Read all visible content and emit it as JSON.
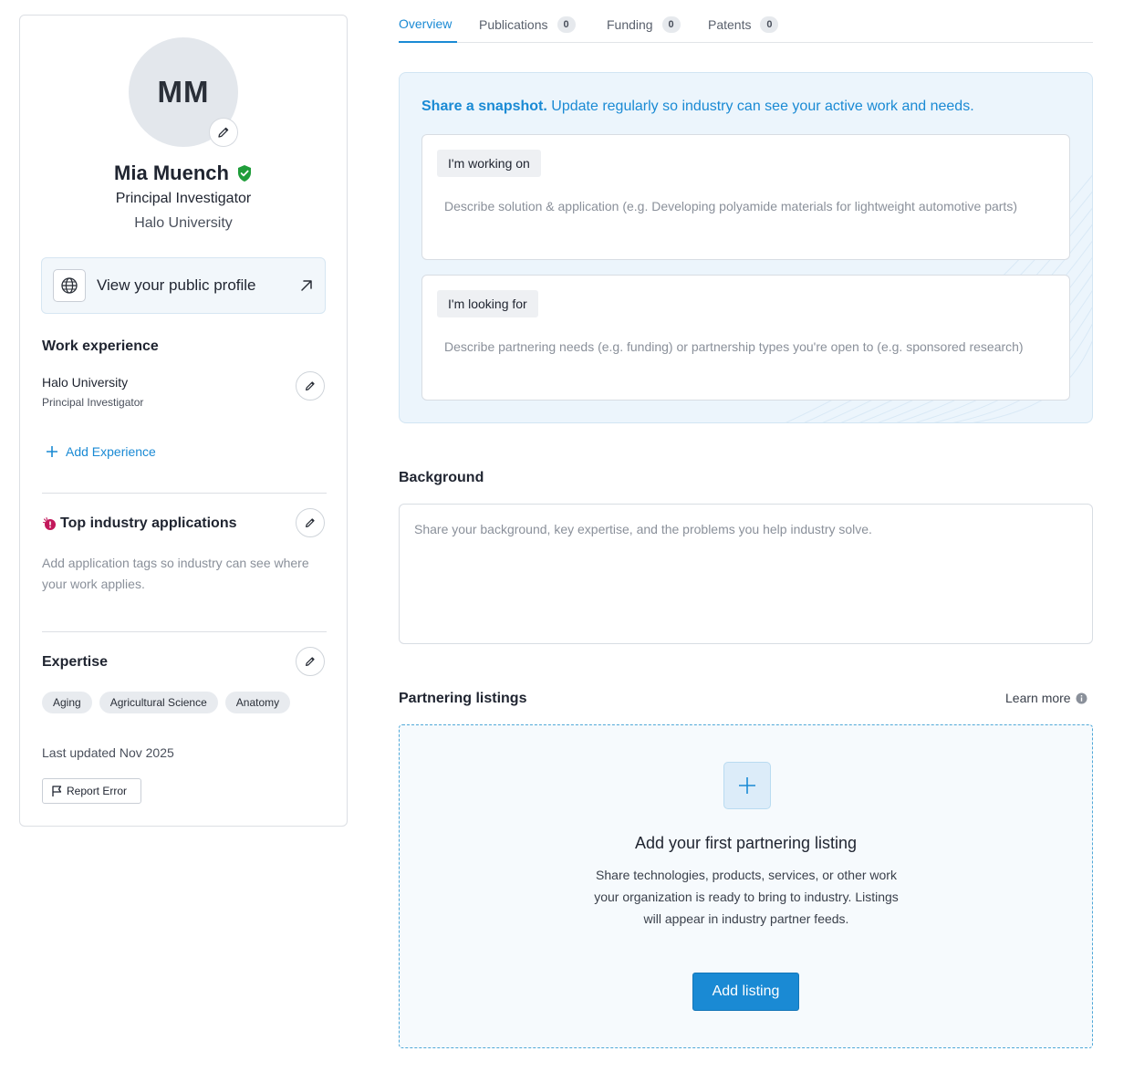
{
  "profile": {
    "initials": "MM",
    "name": "Mia Muench",
    "title": "Principal Investigator",
    "organization": "Halo University",
    "public_profile_label": "View your public profile"
  },
  "work_experience": {
    "heading": "Work experience",
    "items": [
      {
        "organization": "Halo University",
        "role": "Principal Investigator"
      }
    ],
    "add_label": "Add Experience"
  },
  "industry_applications": {
    "heading": "Top industry applications",
    "empty_text": "Add application tags so industry can see where your work applies."
  },
  "expertise": {
    "heading": "Expertise",
    "tags": [
      "Aging",
      "Agricultural Science",
      "Anatomy"
    ]
  },
  "footer": {
    "last_updated": "Last updated Nov 2025",
    "report_label": "Report Error"
  },
  "tabs": [
    {
      "label": "Overview",
      "count": null
    },
    {
      "label": "Publications",
      "count": "0"
    },
    {
      "label": "Funding",
      "count": "0"
    },
    {
      "label": "Patents",
      "count": "0"
    }
  ],
  "snapshot": {
    "heading_bold": "Share a snapshot.",
    "heading_rest": " Update regularly so industry can see your active work and needs.",
    "working_on": {
      "label": "I'm working on",
      "placeholder": "Describe solution & application (e.g. Developing polyamide materials for lightweight automotive parts)"
    },
    "looking_for": {
      "label": "I'm looking for",
      "placeholder": "Describe partnering needs (e.g. funding) or partnership types you're open to (e.g. sponsored research)"
    }
  },
  "background": {
    "heading": "Background",
    "placeholder": "Share your background, key expertise, and the problems you help industry solve."
  },
  "partnering": {
    "heading": "Partnering listings",
    "learn_more": "Learn more",
    "empty_heading": "Add your first partnering listing",
    "empty_description": "Share technologies, products, services, or other work your organization is ready to bring to industry. Listings will appear in industry partner feeds.",
    "add_label": "Add listing"
  },
  "colors": {
    "accent": "#1a8ad4",
    "verified": "#1f9d3a",
    "alert": "#c2185b"
  },
  "icons": {
    "verified": "shield-check-icon",
    "edit": "pencil-icon",
    "globe": "globe-icon",
    "external": "arrow-up-right-icon",
    "add": "plus-icon",
    "flag": "flag-icon",
    "info": "info-icon"
  }
}
